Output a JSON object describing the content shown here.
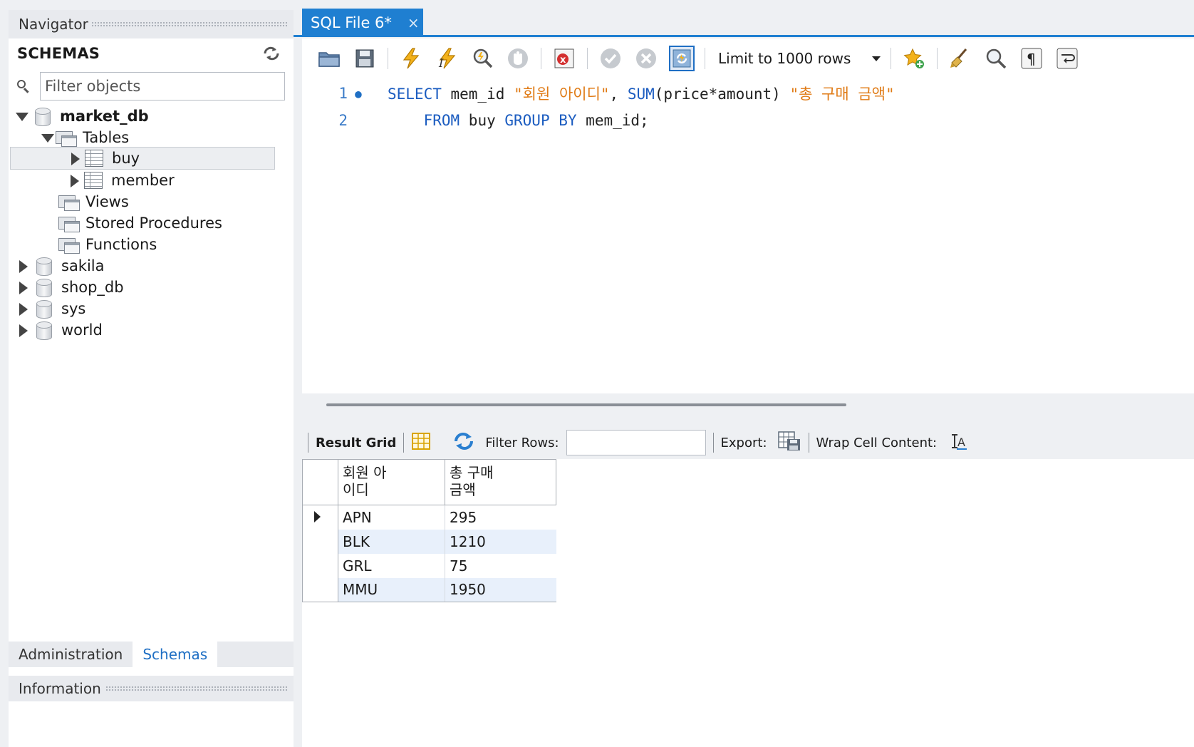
{
  "navigator": {
    "title": "Navigator",
    "schemas_label": "SCHEMAS",
    "filter_placeholder": "Filter objects",
    "tree": {
      "market_db": "market_db",
      "tables": "Tables",
      "buy": "buy",
      "member": "member",
      "views": "Views",
      "procedures": "Stored Procedures",
      "functions": "Functions",
      "sakila": "sakila",
      "shop_db": "shop_db",
      "sys": "sys",
      "world": "world"
    },
    "tabs": {
      "administration": "Administration",
      "schemas": "Schemas"
    },
    "info": "Information"
  },
  "editor_tab": {
    "title": "SQL File 6*",
    "close": "×"
  },
  "toolbar": {
    "limit_label": "Limit to 1000 rows"
  },
  "editor": {
    "line1_no": "1",
    "line2_no": "2",
    "line1": {
      "kw1": "SELECT",
      "id1": " mem_id ",
      "str1": "\"회원 아이디\"",
      "p1": ", ",
      "fn": "SUM",
      "p2": "(price*amount) ",
      "str2": "\"총 구매 금액\""
    },
    "line2": {
      "indent": "    ",
      "kw1": "FROM",
      "id1": " buy ",
      "kw2": "GROUP BY",
      "id2": " mem_id;"
    }
  },
  "result": {
    "grid_label": "Result Grid",
    "filter_label": "Filter Rows:",
    "export_label": "Export:",
    "wrap_label": "Wrap Cell Content:",
    "columns": [
      "회원 아\n이디",
      "총 구매\n금액"
    ],
    "rows": [
      [
        "APN",
        "295"
      ],
      [
        "BLK",
        "1210"
      ],
      [
        "GRL",
        "75"
      ],
      [
        "MMU",
        "1950"
      ]
    ]
  },
  "colors": {
    "accent": "#1f7fd1",
    "keyword": "#1b5cc0",
    "string": "#e07b16"
  }
}
